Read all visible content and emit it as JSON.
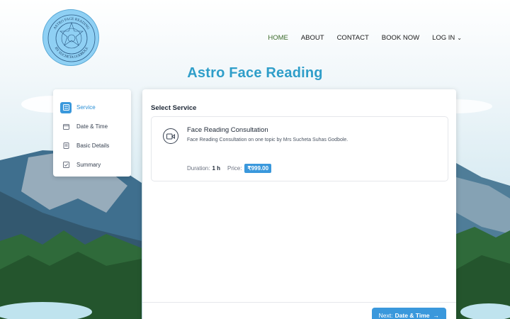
{
  "logo": {
    "top_text": "ASTRO FACE READING",
    "bottom_text": "BY SUCHETA GODBOLE"
  },
  "nav": {
    "items": [
      "HOME",
      "ABOUT",
      "CONTACT",
      "BOOK NOW",
      "LOG IN"
    ],
    "active": "HOME"
  },
  "page_title": "Astro Face Reading",
  "steps": [
    {
      "label": "Service",
      "icon": "service-icon",
      "active": true
    },
    {
      "label": "Date & Time",
      "icon": "calendar-icon",
      "active": false
    },
    {
      "label": "Basic Details",
      "icon": "details-icon",
      "active": false
    },
    {
      "label": "Summary",
      "icon": "summary-icon",
      "active": false
    }
  ],
  "panel": {
    "title": "Select Service",
    "service": {
      "name": "Face Reading Consultation",
      "description": "Face Reading Consultation on one topic by Mrs Sucheta Suhas Godbole.",
      "duration_label": "Duration:",
      "duration_value": "1 h",
      "price_label": "Price:",
      "price_value": "₹999.00"
    },
    "next_button": {
      "prefix": "Next:",
      "target": "Date & Time"
    }
  },
  "colors": {
    "accent": "#3a98dc",
    "title": "#2f9ec9",
    "nav_active": "#3b6b2a"
  }
}
